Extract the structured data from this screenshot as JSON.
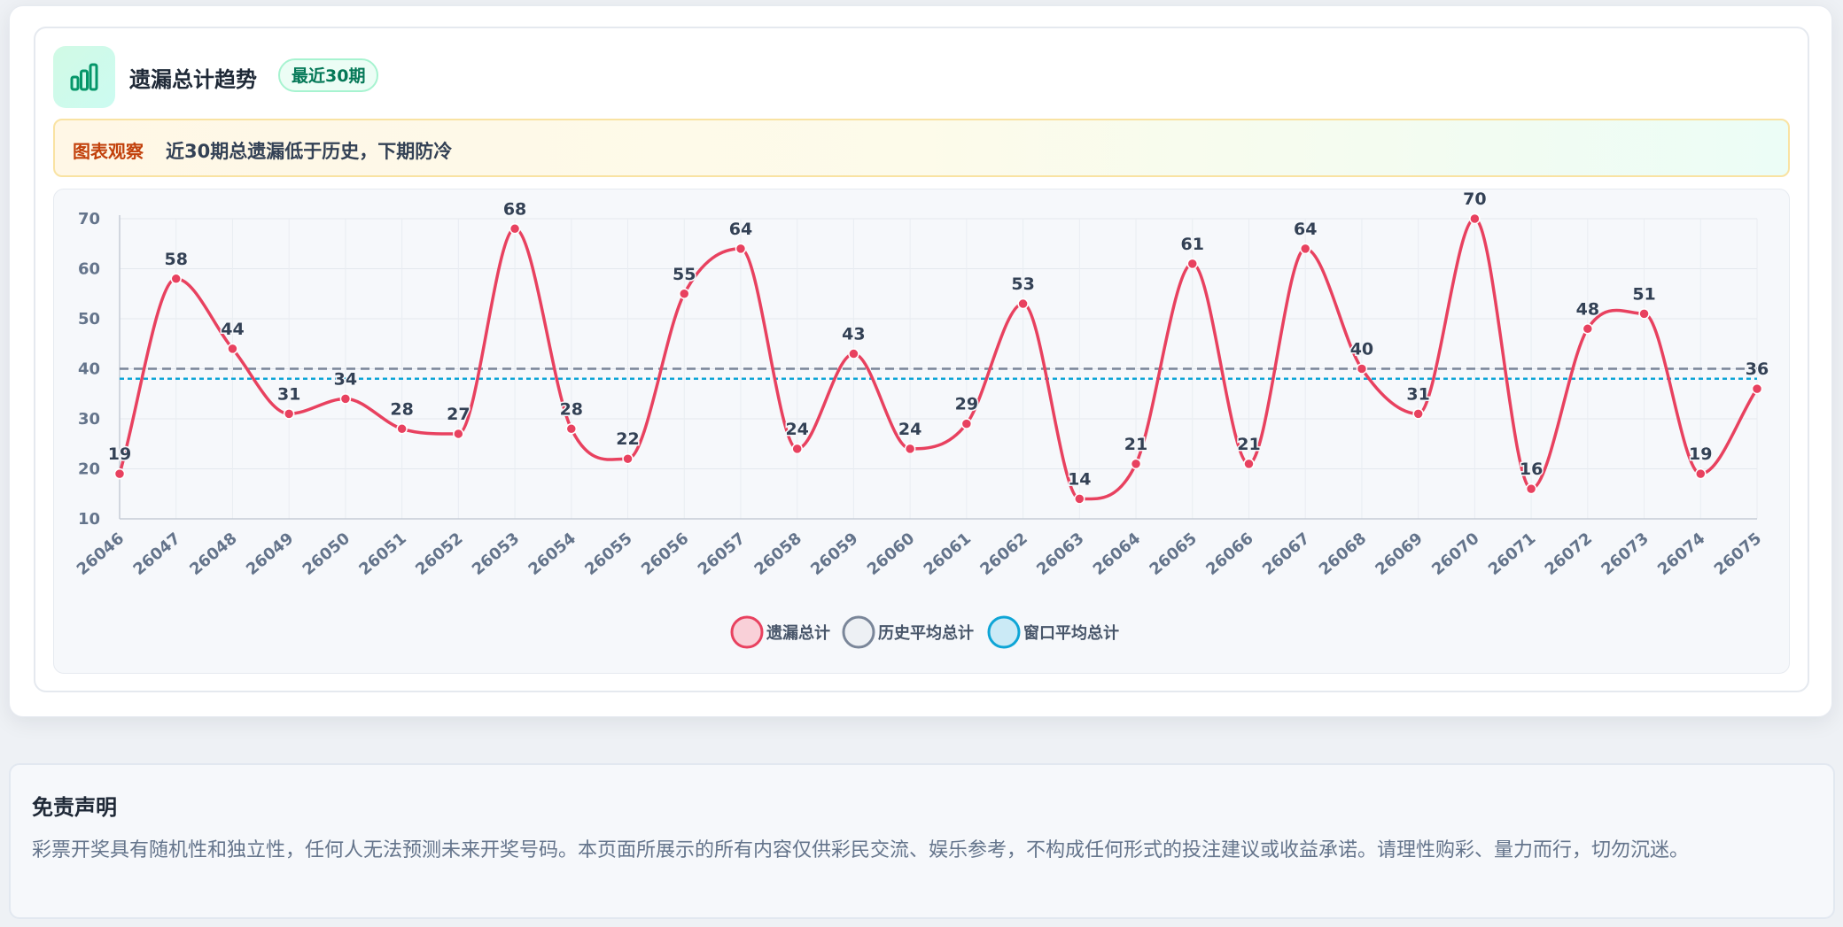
{
  "header": {
    "title": "遗漏总计趋势",
    "badge": "最近30期",
    "icon": "bar-chart-icon"
  },
  "observation": {
    "label": "图表观察",
    "text": "近30期总遗漏低于历史，下期防冷"
  },
  "colors": {
    "series_line": "#e8415f",
    "history_avg": "#7a8699",
    "window_avg": "#0ea5d6",
    "accent_green": "#059669"
  },
  "chart_data": {
    "type": "line",
    "categories": [
      "26046",
      "26047",
      "26048",
      "26049",
      "26050",
      "26051",
      "26052",
      "26053",
      "26054",
      "26055",
      "26056",
      "26057",
      "26058",
      "26059",
      "26060",
      "26061",
      "26062",
      "26063",
      "26064",
      "26065",
      "26066",
      "26067",
      "26068",
      "26069",
      "26070",
      "26071",
      "26072",
      "26073",
      "26074",
      "26075"
    ],
    "series": [
      {
        "name": "遗漏总计",
        "values": [
          19,
          58,
          44,
          31,
          34,
          28,
          27,
          68,
          28,
          22,
          55,
          64,
          24,
          43,
          24,
          29,
          53,
          14,
          21,
          61,
          21,
          64,
          40,
          31,
          70,
          16,
          48,
          51,
          19,
          36
        ]
      }
    ],
    "reference_lines": [
      {
        "name": "历史平均总计",
        "value": 40,
        "style": "dashed"
      },
      {
        "name": "窗口平均总计",
        "value": 38,
        "style": "dotted"
      }
    ],
    "ylim": [
      10,
      70
    ],
    "yticks": [
      10,
      20,
      30,
      40,
      50,
      60,
      70
    ],
    "grid": true,
    "legend_position": "bottom",
    "title": "",
    "xlabel": "",
    "ylabel": ""
  },
  "disclaimer": {
    "title": "免责声明",
    "text": "彩票开奖具有随机性和独立性，任何人无法预测未来开奖号码。本页面所展示的所有内容仅供彩民交流、娱乐参考，不构成任何形式的投注建议或收益承诺。请理性购彩、量力而行，切勿沉迷。"
  }
}
